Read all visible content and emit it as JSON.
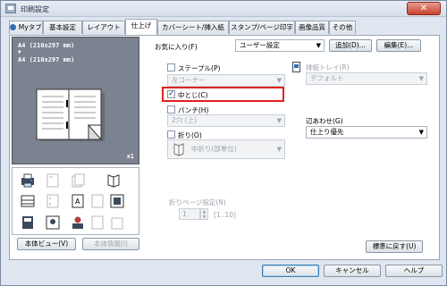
{
  "window": {
    "title": "印刷設定",
    "close_label": "✕"
  },
  "tabs": [
    "Myタブ",
    "基本設定",
    "レイアウト",
    "仕上げ",
    "カバーシート/挿入紙",
    "スタンプ/ページ印字",
    "画像品質",
    "その他"
  ],
  "active_tab": "仕上げ",
  "favorites": {
    "label": "お気に入り(F)",
    "value": "ユーザー設定",
    "add_label": "追加(D)...",
    "edit_label": "編集(E)..."
  },
  "preview": {
    "line1": "A4 (210x297 mm)",
    "arrow": "▼",
    "line2": "A4 (210x297 mm)",
    "copies": "x1"
  },
  "staple": {
    "label": "ステープル(P)",
    "value": "左コーナー"
  },
  "center_staple": {
    "label": "中とじ(C)"
  },
  "punch": {
    "label": "パンチ(H)",
    "value": "2穴 (上)"
  },
  "fold": {
    "label": "折り(O)",
    "value": "中折り(部単位)"
  },
  "output_tray": {
    "label": "排紙トレイ(R)",
    "value": "デフォルト"
  },
  "alignment": {
    "label": "辺あわせ(G)",
    "value": "仕上り優先"
  },
  "fold_pages": {
    "label": "折りページ指定(N)",
    "value": "1",
    "range": "[1..10]"
  },
  "buttons": {
    "device_view": "本体ビュー(V)",
    "device_info": "本体情報(I)",
    "restore_default": "標準に戻す(U)",
    "ok": "OK",
    "cancel": "キャンセル",
    "help": "ヘルプ"
  }
}
